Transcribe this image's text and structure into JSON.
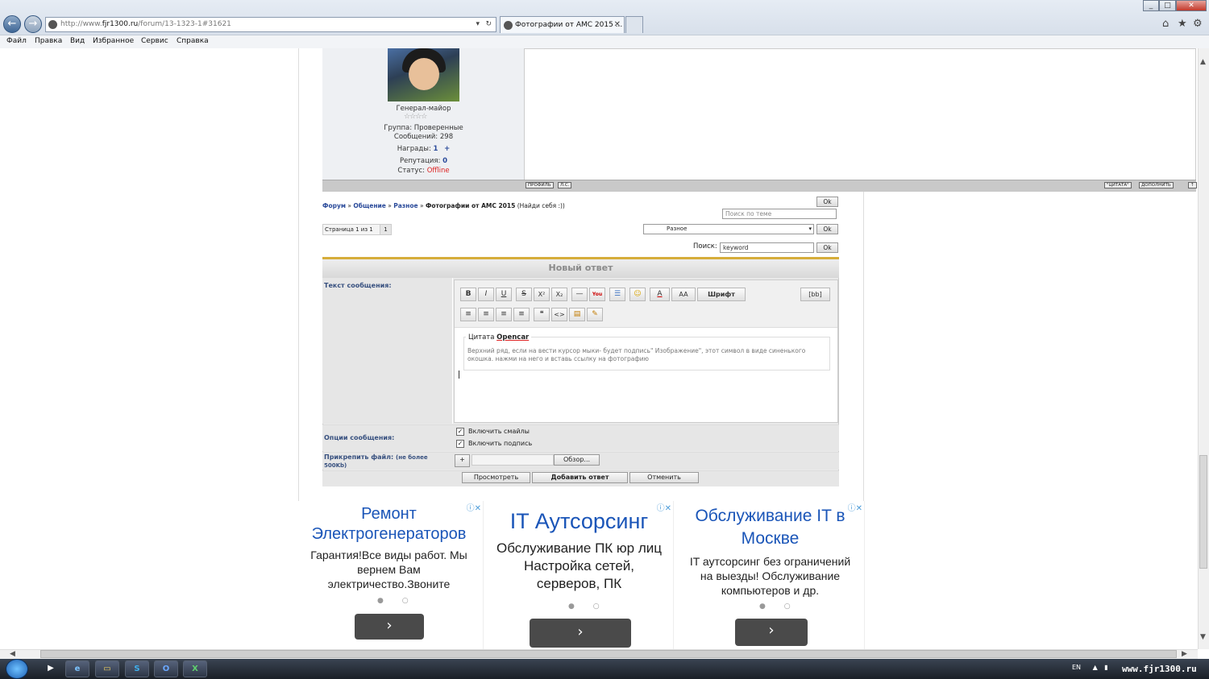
{
  "browser": {
    "url_prefix": "http://www.",
    "url_domain": "fjr1300.ru",
    "url_path": "/forum/13-1323-1#31621",
    "tab_title": "Фотографии от АМС 2015 ...",
    "tab_close": "✕",
    "menu": [
      "Файл",
      "Правка",
      "Вид",
      "Избранное",
      "Сервис",
      "Справка"
    ]
  },
  "author": {
    "rank": "Генерал-майор",
    "stars": "☆☆☆☆",
    "group_label": "Группа: Проверенные",
    "posts_label": "Сообщений: 298",
    "awards_label": "Награды:",
    "awards_value": "1",
    "awards_plus": "+",
    "reputation_label": "Репутация:",
    "reputation_value": "0",
    "status_label": "Статус:",
    "status_value": "Offline"
  },
  "post_footer": {
    "profile": "ПРОФИЛЬ",
    "pm": "Л.С.",
    "quote": "\"ЦИТАТА\"",
    "edit": "ДОПОЛНИТЬ",
    "top": "↑"
  },
  "breadcrumb": {
    "forum": "Форум",
    "sep": "»",
    "section": "Общение",
    "subsection": "Разное",
    "current": "Фотографии от АМС 2015",
    "find_self": "(Найди себя :))"
  },
  "topic_search": {
    "placeholder": "Поиск по теме",
    "ok": "Ok"
  },
  "pagination": {
    "label": "Страница 1 из 1",
    "current": "1"
  },
  "jump": {
    "selected": "Разное",
    "ok": "Ok"
  },
  "search": {
    "label": "Поиск:",
    "value": "keyword",
    "ok": "Ok"
  },
  "reply_form": {
    "title": "Новый ответ",
    "text_label": "Текст сообщения:",
    "options_label": "Опции сообщения:",
    "attach_label": "Прикрепить файл:",
    "attach_note": "(не более 500Kb)",
    "toolbar": {
      "bold": "B",
      "italic": "I",
      "underline": "U",
      "strike": "S",
      "sup": "X²",
      "sub": "X₂",
      "hr": "—",
      "youtube": "You",
      "list": "☰",
      "smile": "☺",
      "color": "A",
      "size": "AA",
      "font": "Шрифт",
      "bb": "[bb]",
      "align_left": "≡",
      "align_center": "≡",
      "align_right": "≡",
      "justify": "≡",
      "quote": "❝",
      "code": "<>",
      "img": "▤",
      "url": "✎"
    },
    "quote_title_prefix": "Цитата",
    "quote_author": "Opencar",
    "quote_text": "Верхний ряд, если на вести курсор мыки- будет подпись\" Изображение\", этот символ в виде синенького окошка. нажми на него и вставь ссылку на фотографию",
    "option_smiles": "Включить смайлы",
    "option_signature": "Включить подпись",
    "checkmark": "✓",
    "add_file": "+",
    "browse": "Обзор...",
    "preview": "Просмотреть",
    "submit": "Добавить ответ",
    "cancel": "Отменить"
  },
  "ads": [
    {
      "title": "Ремонт Электрогенераторов",
      "text": "Гарантия!Все виды работ. Мы вернем Вам электричество.Звоните"
    },
    {
      "title": "IT Аутсорсинг",
      "text": "Обслуживание ПК юр лиц Настройка сетей, серверов, ПК"
    },
    {
      "title": "Обслуживание IT в Москве",
      "text": "IT аутсорсинг без ограничений на выезды! Обслуживание компьютеров и др."
    }
  ],
  "ad_next": "›",
  "ad_dots": "● ○",
  "ad_choices": "ⓘ✕",
  "taskbar": {
    "lang": "EN",
    "watermark": "www.fjr1300.ru"
  }
}
